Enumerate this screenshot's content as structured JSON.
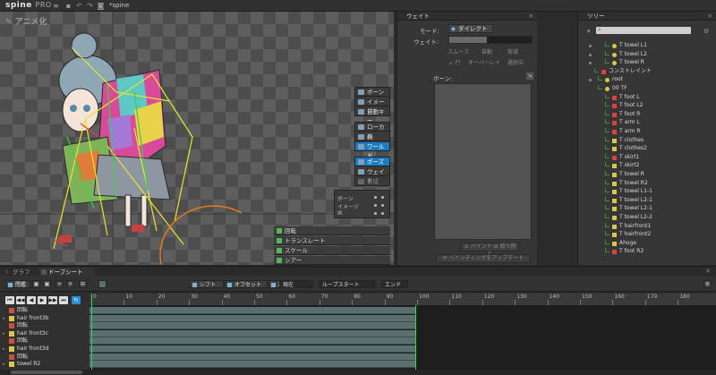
{
  "app": {
    "logo": "spine",
    "edition": "PRO",
    "filename": "*spine"
  },
  "viewport": {
    "mode_label": "アニメ化",
    "tools_top": [
      "ボーン",
      "イメージ",
      "自動キー"
    ],
    "tools_axis": [
      "ローカル",
      "親",
      "ワールド"
    ],
    "tools_mode": [
      "ポーズ",
      "ウェイト",
      "作成"
    ],
    "active_axis": "ワールド",
    "active_mode": "ポーズ",
    "vis_rows": [
      "ボーン",
      "イメージ",
      "IK"
    ],
    "transform_rows": [
      "回転",
      "トランスレート",
      "スケール",
      "シアー"
    ]
  },
  "weights": {
    "title": "ウェイト",
    "mode_label": "モード:",
    "mode_value": "ダイレクト",
    "weight_label": "ウェイト:",
    "smooth": "スムーズ",
    "auto": "自動",
    "prune": "剪減",
    "lock": "↙ 行",
    "overlay": "オーバーレイ",
    "selection_only": "選択中",
    "bones_label": "ボーン:",
    "bind": "バインド",
    "remove": "取り除く",
    "update_binding": "バインディングをアップデート"
  },
  "tree": {
    "title": "ツリー",
    "rows": [
      {
        "label": "T towel L1",
        "icon": "bone-icon",
        "color": "#d8c84a"
      },
      {
        "label": "T towel L2",
        "icon": "bone-icon",
        "color": "#d8c84a"
      },
      {
        "label": "T towel R",
        "icon": "bone-icon",
        "color": "#d8c84a"
      },
      {
        "label": "コンストレイント",
        "icon": "constraint-icon",
        "color": "#e04040"
      },
      {
        "label": "root",
        "icon": "bone-icon",
        "color": "#d8c84a"
      },
      {
        "label": "00 TF",
        "icon": "bone-icon",
        "color": "#d8c84a"
      },
      {
        "label": "T foot L",
        "icon": "ik-icon",
        "color": "#e04040"
      },
      {
        "label": "T foot L2",
        "icon": "ik-icon",
        "color": "#e04040"
      },
      {
        "label": "T foot R",
        "icon": "ik-icon",
        "color": "#e04040"
      },
      {
        "label": "T arm L",
        "icon": "ik-icon",
        "color": "#e04040"
      },
      {
        "label": "T arm R",
        "icon": "ik-icon",
        "color": "#e04040"
      },
      {
        "label": "T clothes",
        "icon": "transform-icon",
        "color": "#d8c84a"
      },
      {
        "label": "T clothes2",
        "icon": "transform-icon",
        "color": "#d8c84a"
      },
      {
        "label": "T skirt1",
        "icon": "ik-icon",
        "color": "#e04040"
      },
      {
        "label": "T skirt2",
        "icon": "transform-icon",
        "color": "#d8c84a"
      },
      {
        "label": "T towel R",
        "icon": "transform-icon",
        "color": "#d8c84a"
      },
      {
        "label": "T towel R2",
        "icon": "transform-icon",
        "color": "#d8c84a"
      },
      {
        "label": "T towel L1-1",
        "icon": "transform-icon",
        "color": "#d8c84a"
      },
      {
        "label": "T towel L2-1",
        "icon": "transform-icon",
        "color": "#d8c84a"
      },
      {
        "label": "T towel L2-1",
        "icon": "transform-icon",
        "color": "#d8c84a"
      },
      {
        "label": "T towel L2-2",
        "icon": "transform-icon",
        "color": "#d8c84a"
      },
      {
        "label": "T hairfront1",
        "icon": "transform-icon",
        "color": "#d8c84a"
      },
      {
        "label": "T hairfront2",
        "icon": "transform-icon",
        "color": "#d8c84a"
      },
      {
        "label": "Ahoge",
        "icon": "transform-icon",
        "color": "#d8c84a"
      },
      {
        "label": "T foot R2",
        "icon": "ik-icon",
        "color": "#e04040"
      }
    ]
  },
  "bottom": {
    "tab_graph": "グラフ",
    "tab_dopesheet": "ドープシート",
    "toolbar": {
      "open": "閉鑑",
      "shift": "シフト",
      "offset": "オフセット",
      "adjust": "調整",
      "current": "現在",
      "loop_start": "ループスタート",
      "end": "エンド"
    },
    "ruler_ticks": [
      "0",
      "10",
      "20",
      "30",
      "40",
      "50",
      "60",
      "70",
      "80",
      "90",
      "100",
      "110",
      "120",
      "130",
      "140",
      "150",
      "160",
      "170",
      "180"
    ],
    "tracks": [
      "回転",
      "hair front3b",
      "回転",
      "hair front3c",
      "回転",
      "hair front3d",
      "回転",
      "towel R2"
    ]
  },
  "colors": {
    "accent": "#1c7bc0",
    "playhead": "#2fd45a",
    "track": "#5a6d6f"
  }
}
